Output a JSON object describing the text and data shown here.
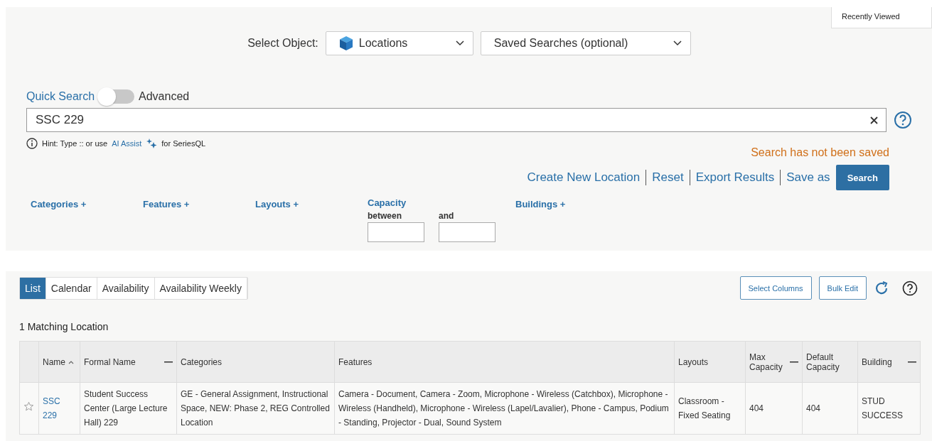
{
  "recently_viewed": {
    "label": "Recently Viewed"
  },
  "select_object": {
    "label": "Select Object:",
    "value": "Locations"
  },
  "saved_searches": {
    "value": "Saved Searches (optional)"
  },
  "search_mode": {
    "quick_label": "Quick Search",
    "advanced_label": "Advanced",
    "on": false
  },
  "search_field": {
    "value": "SSC 229"
  },
  "hint": {
    "prefix": "Hint: Type :: or use",
    "link": "AI Assist",
    "suffix": "for SeriesQL"
  },
  "save_status": "Search has not been saved",
  "actions": [
    {
      "label": "Create New Location",
      "kind": "link"
    },
    {
      "label": "Reset",
      "kind": "link"
    },
    {
      "label": "Export Results",
      "kind": "link"
    },
    {
      "label": "Save as",
      "kind": "link"
    },
    {
      "label": "Search",
      "kind": "button"
    }
  ],
  "filters": [
    {
      "label": "Categories +",
      "kind": "link"
    },
    {
      "label": "Features +",
      "kind": "link"
    },
    {
      "label": "Layouts +",
      "kind": "link"
    },
    {
      "label": "Capacity",
      "kind": "range",
      "from_label": "between",
      "to_label": "and"
    },
    {
      "label": "Buildings +",
      "kind": "link"
    }
  ],
  "view_tabs": [
    {
      "label": "List",
      "selected": true
    },
    {
      "label": "Calendar",
      "selected": false
    },
    {
      "label": "Availability",
      "selected": false
    },
    {
      "label": "Availability Weekly",
      "selected": false
    }
  ],
  "toolbar_buttons": [
    "Select Columns",
    "Bulk Edit"
  ],
  "result_count": "1 Matching Location",
  "table": {
    "columns": [
      {
        "label": "Name",
        "sorted": true,
        "collapse": false
      },
      {
        "label": "Formal Name",
        "sorted": false,
        "collapse": true
      },
      {
        "label": "Categories",
        "sorted": false,
        "collapse": false
      },
      {
        "label": "Features",
        "sorted": false,
        "collapse": false
      },
      {
        "label": "Layouts",
        "sorted": false,
        "collapse": false
      },
      {
        "label": "Max Capacity",
        "sorted": false,
        "collapse": true
      },
      {
        "label": "Default Capacity",
        "sorted": false,
        "collapse": false
      },
      {
        "label": "Building",
        "sorted": false,
        "collapse": true
      }
    ],
    "rows": [
      {
        "starred": false,
        "cells": [
          "SSC 229",
          "Student Success Center (Large Lecture Hall) 229",
          "GE - General Assignment, Instructional Space, NEW: Phase 2, REG Controlled Location",
          "Camera - Document, Camera - Zoom, Microphone - Wireless (Catchbox), Microphone - Wireless (Handheld), Microphone - Wireless (Lapel/Lavalier), Phone - Campus, Podium - Standing, Projector - Dual, Sound System",
          "Classroom - Fixed Seating",
          "404",
          "404",
          "STUD SUCCESS"
        ]
      }
    ]
  }
}
